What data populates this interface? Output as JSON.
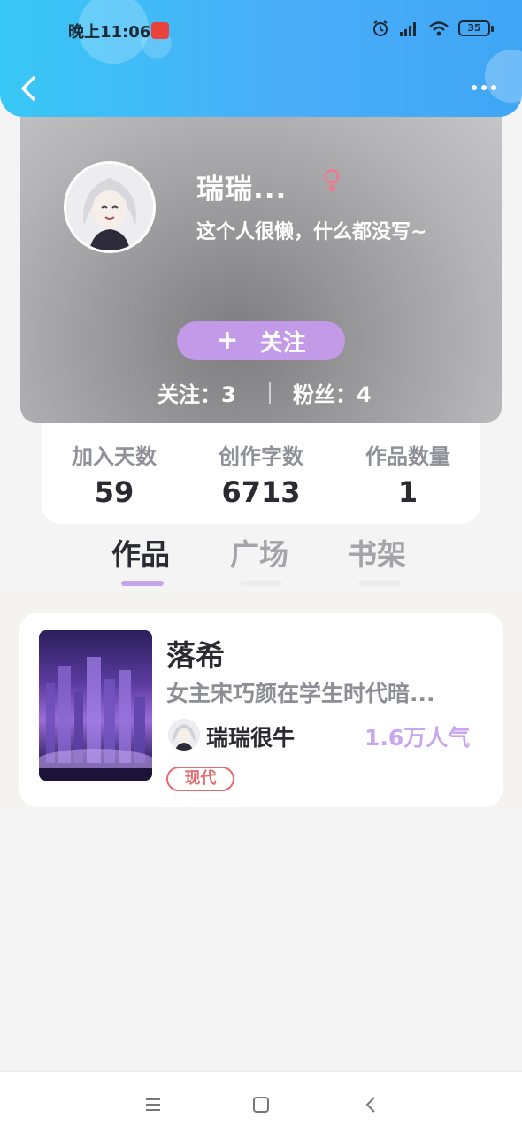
{
  "status_bar": {
    "time": "晚上11:06",
    "battery": "35",
    "icons": [
      "alarm-icon",
      "signal-icon",
      "wifi-icon",
      "battery-icon"
    ]
  },
  "header": {
    "back_icon": "chevron-left-icon",
    "more_icon": "more-icon"
  },
  "profile": {
    "username": "瑞瑞...",
    "gender_symbol": "♀",
    "bio": "这个人很懒，什么都没写~",
    "follow_plus": "+",
    "follow_label": "关注",
    "following": "关注：3",
    "fans": "粉丝：4"
  },
  "stats": [
    {
      "label": "加入天数",
      "value": "59"
    },
    {
      "label": "创作字数",
      "value": "6713"
    },
    {
      "label": "作品数量",
      "value": "1"
    }
  ],
  "tabs": [
    {
      "label": "作品",
      "active": true
    },
    {
      "label": "广场",
      "active": false
    },
    {
      "label": "书架",
      "active": false
    }
  ],
  "works": [
    {
      "title": "落希",
      "description": "女主宋巧颜在学生时代暗...",
      "author": "瑞瑞很牛",
      "popularity": "1.6万人气",
      "tag": "现代"
    }
  ],
  "colors": {
    "header_gradient_start": "#38c8f6",
    "header_gradient_end": "#3fa6f6",
    "accent_purple": "#c29ae8",
    "tag_red": "#e36b70",
    "gender_pink": "#f0788f"
  }
}
